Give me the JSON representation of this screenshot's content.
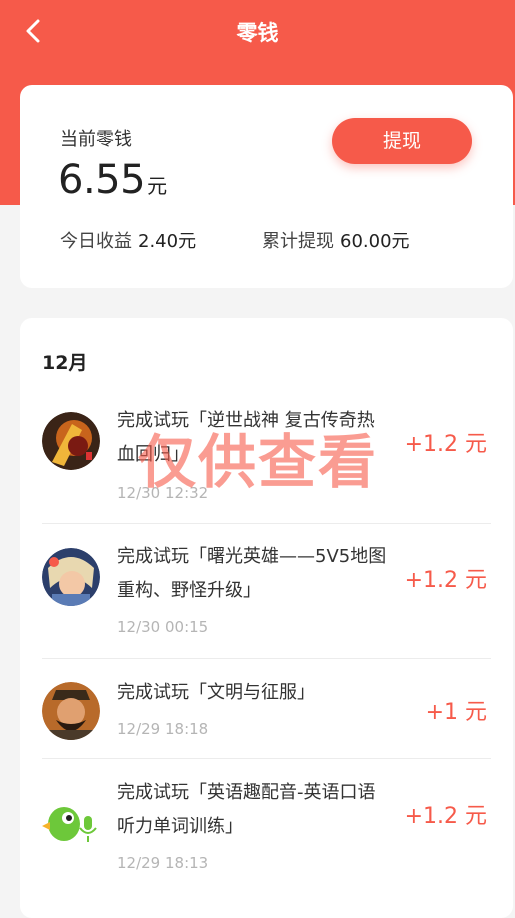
{
  "header": {
    "title": "零钱",
    "back_icon": "chevron-left-icon"
  },
  "balance": {
    "label": "当前零钱",
    "amount": "6.55",
    "unit": "元",
    "withdraw_label": "提现",
    "today_label": "今日收益",
    "today_value": "2.40元",
    "total_label": "累计提现",
    "total_value": "60.00元"
  },
  "records": {
    "month": "12月",
    "items": [
      {
        "title": "完成试玩「逆世战神 复古传奇热血回归」",
        "time": "12/30 12:32",
        "amount": "+1.2 元",
        "icon": "game-warrior-avatar-icon"
      },
      {
        "title": "完成试玩「曙光英雄——5V5地图重构、野怪升级」",
        "time": "12/30 00:15",
        "amount": "+1.2 元",
        "icon": "game-hero-avatar-icon"
      },
      {
        "title": "完成试玩「文明与征服」",
        "time": "12/29 18:18",
        "amount": "+1 元",
        "icon": "game-general-avatar-icon"
      },
      {
        "title": "完成试玩「英语趣配音-英语口语听力单词训练」",
        "time": "12/29 18:13",
        "amount": "+1.2 元",
        "icon": "green-parrot-icon"
      }
    ]
  },
  "watermark": "仅供查看",
  "colors": {
    "accent": "#f65a4a",
    "background": "#f4f4f4"
  }
}
